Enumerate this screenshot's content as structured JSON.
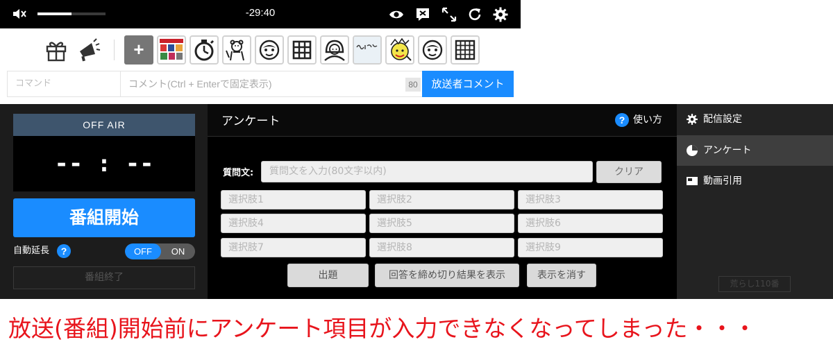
{
  "player": {
    "time": "-29:40",
    "volume_level": 0.5,
    "icons": [
      "mute-icon",
      "eye-icon",
      "comment-close-icon",
      "fullscreen-icon",
      "reload-icon",
      "gear-icon"
    ]
  },
  "tools": {
    "icons": [
      "gift-icon",
      "megaphone-icon"
    ],
    "plus_label": "+",
    "stickers": [
      "sticker-collage",
      "sticker-timer",
      "sticker-bear",
      "sticker-face",
      "sticker-grid",
      "sticker-person",
      "sticker-handwriting",
      "sticker-character",
      "sticker-face-2",
      "sticker-grid-2"
    ]
  },
  "comment_bar": {
    "command_placeholder": "コマンド",
    "comment_placeholder": "コメント(Ctrl + Enterで固定表示)",
    "char_limit": "80",
    "submit_label": "放送者コメント"
  },
  "status": {
    "air_label": "OFF AIR",
    "clock": "-- : --",
    "start_label": "番組開始",
    "auto_extend_label": "自動延長",
    "toggle_off": "OFF",
    "toggle_on": "ON",
    "end_label": "番組終了"
  },
  "survey": {
    "title": "アンケート",
    "howto_label": "使い方",
    "question_label": "質問文:",
    "question_placeholder": "質問文を入力(80文字以内)",
    "clear_label": "クリア",
    "choices": [
      "選択肢1",
      "選択肢2",
      "選択肢3",
      "選択肢4",
      "選択肢5",
      "選択肢6",
      "選択肢7",
      "選択肢8",
      "選択肢9"
    ],
    "ask_label": "出題",
    "close_label": "回答を締め切り結果を表示",
    "hide_label": "表示を消す"
  },
  "side_menu": {
    "items": [
      {
        "label": "配信設定",
        "icon": "gear-icon"
      },
      {
        "label": "アンケート",
        "icon": "pie-chart-icon"
      },
      {
        "label": "動画引用",
        "icon": "video-quote-icon"
      }
    ],
    "troll_label": "荒らし110番"
  },
  "caption": "放送(番組)開始前にアンケート項目が入力できなくなってしまった・・・",
  "colors": {
    "accent_blue": "#1a8cff",
    "caption_red": "#e8141c",
    "air_header": "#3e556d"
  }
}
